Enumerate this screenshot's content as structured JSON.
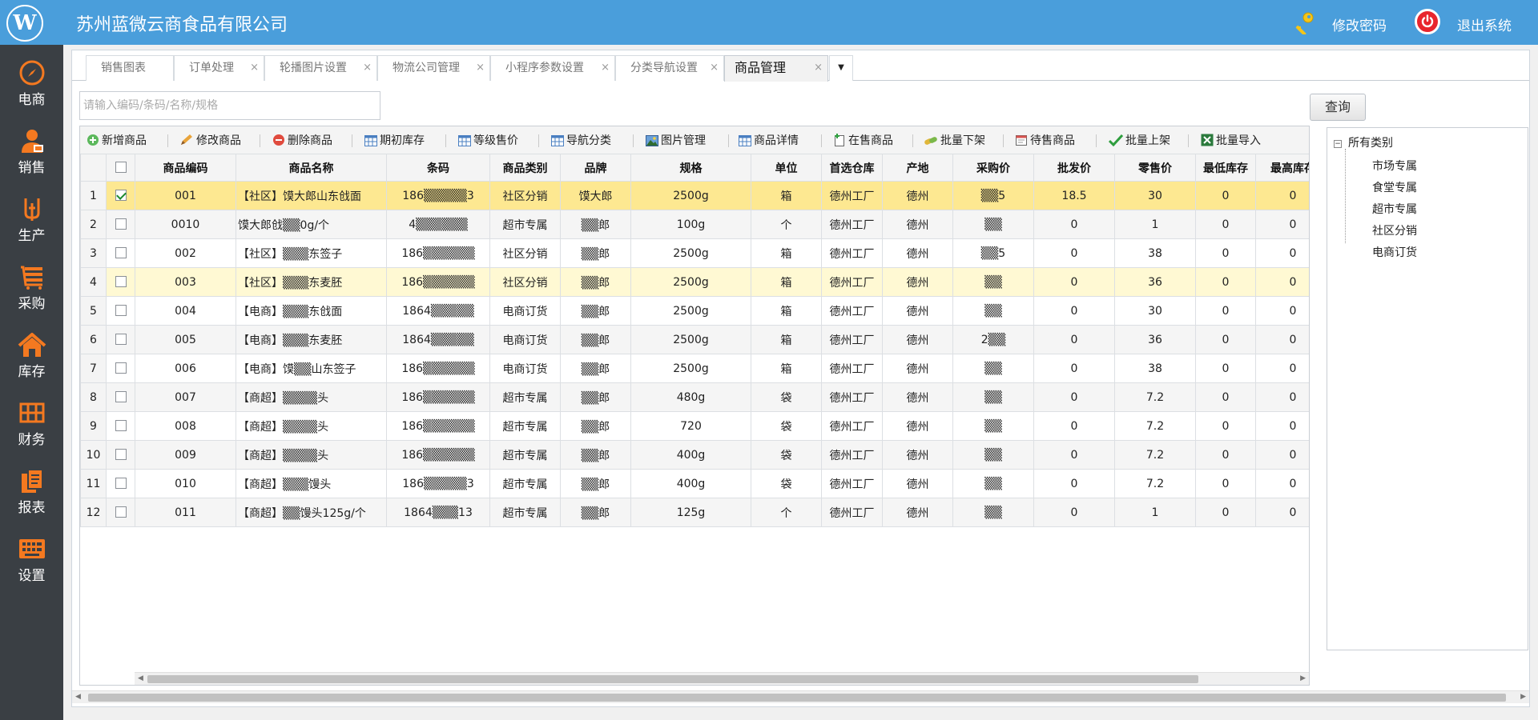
{
  "header": {
    "company_name": "苏州蓝微云商食品有限公司",
    "change_password": "修改密码",
    "logout": "退出系统"
  },
  "sidebar": {
    "items": [
      {
        "label": "电商",
        "icon": "compass-icon"
      },
      {
        "label": "销售",
        "icon": "salesperson-icon"
      },
      {
        "label": "生产",
        "icon": "production-icon"
      },
      {
        "label": "采购",
        "icon": "purchase-list-icon"
      },
      {
        "label": "库存",
        "icon": "warehouse-home-icon"
      },
      {
        "label": "财务",
        "icon": "finance-grid-icon"
      },
      {
        "label": "报表",
        "icon": "report-icon"
      },
      {
        "label": "设置",
        "icon": "keyboard-settings-icon"
      }
    ],
    "accent_color": "#f47920"
  },
  "tabs": [
    {
      "label": "销售图表"
    },
    {
      "label": "订单处理"
    },
    {
      "label": "轮播图片设置"
    },
    {
      "label": "物流公司管理"
    },
    {
      "label": "小程序参数设置"
    },
    {
      "label": "分类导航设置"
    },
    {
      "label": "商品管理"
    }
  ],
  "tab_close_glyph": "×",
  "search": {
    "placeholder": "请输入编码/条码/名称/规格",
    "button": "查询"
  },
  "toolbar": [
    {
      "label": "新增商品",
      "icon": "add-icon"
    },
    {
      "label": "修改商品",
      "icon": "edit-pencil-icon"
    },
    {
      "label": "删除商品",
      "icon": "delete-icon"
    },
    {
      "label": "期初库存",
      "icon": "table-icon"
    },
    {
      "label": "等级售价",
      "icon": "table-icon"
    },
    {
      "label": "导航分类",
      "icon": "table-icon"
    },
    {
      "label": "图片管理",
      "icon": "image-icon"
    },
    {
      "label": "商品详情",
      "icon": "table-icon"
    },
    {
      "label": "在售商品",
      "icon": "document-add-icon"
    },
    {
      "label": "批量下架",
      "icon": "pills-icon"
    },
    {
      "label": "待售商品",
      "icon": "calendar-icon"
    },
    {
      "label": "批量上架",
      "icon": "checkmark-icon"
    },
    {
      "label": "批量导入",
      "icon": "excel-icon"
    }
  ],
  "table": {
    "columns": [
      "商品编码",
      "商品名称",
      "条码",
      "商品类别",
      "品牌",
      "规格",
      "单位",
      "首选仓库",
      "产地",
      "采购价",
      "批发价",
      "零售价",
      "最低库存",
      "最高库存"
    ],
    "rows": [
      {
        "num": "1",
        "checked": true,
        "code": "001",
        "name": "【社区】馍大郎山东戗面",
        "barcode": "186▒▒▒▒▒3",
        "category": "社区分销",
        "brand": "馍大郎",
        "spec": "2500g",
        "unit": "箱",
        "warehouse": "德州工厂",
        "origin": "德州",
        "purchase": "▒▒5",
        "wholesale": "18.5",
        "retail": "30",
        "min": "0",
        "max": "0"
      },
      {
        "num": "2",
        "checked": false,
        "code": "0010",
        "name": "馍大郎戗▒▒0g/个",
        "barcode": "4▒▒▒▒▒▒",
        "category": "超市专属",
        "brand": "▒▒郎",
        "spec": "100g",
        "unit": "个",
        "warehouse": "德州工厂",
        "origin": "德州",
        "purchase": "▒▒",
        "wholesale": "0",
        "retail": "1",
        "min": "0",
        "max": "0"
      },
      {
        "num": "3",
        "checked": false,
        "code": "002",
        "name": "【社区】▒▒▒东签子",
        "barcode": "186▒▒▒▒▒▒",
        "category": "社区分销",
        "brand": "▒▒郎",
        "spec": "2500g",
        "unit": "箱",
        "warehouse": "德州工厂",
        "origin": "德州",
        "purchase": "▒▒5",
        "wholesale": "0",
        "retail": "38",
        "min": "0",
        "max": "0"
      },
      {
        "num": "4",
        "checked": false,
        "code": "003",
        "name": "【社区】▒▒▒东麦胚",
        "barcode": "186▒▒▒▒▒▒",
        "category": "社区分销",
        "brand": "▒▒郎",
        "spec": "2500g",
        "unit": "箱",
        "warehouse": "德州工厂",
        "origin": "德州",
        "purchase": "▒▒",
        "wholesale": "0",
        "retail": "36",
        "min": "0",
        "max": "0"
      },
      {
        "num": "5",
        "checked": false,
        "code": "004",
        "name": "【电商】▒▒▒东戗面",
        "barcode": "1864▒▒▒▒▒",
        "category": "电商订货",
        "brand": "▒▒郎",
        "spec": "2500g",
        "unit": "箱",
        "warehouse": "德州工厂",
        "origin": "德州",
        "purchase": "▒▒",
        "wholesale": "0",
        "retail": "30",
        "min": "0",
        "max": "0"
      },
      {
        "num": "6",
        "checked": false,
        "code": "005",
        "name": "【电商】▒▒▒东麦胚",
        "barcode": "1864▒▒▒▒▒",
        "category": "电商订货",
        "brand": "▒▒郎",
        "spec": "2500g",
        "unit": "箱",
        "warehouse": "德州工厂",
        "origin": "德州",
        "purchase": "2▒▒",
        "wholesale": "0",
        "retail": "36",
        "min": "0",
        "max": "0"
      },
      {
        "num": "7",
        "checked": false,
        "code": "006",
        "name": "【电商】馍▒▒山东签子",
        "barcode": "186▒▒▒▒▒▒",
        "category": "电商订货",
        "brand": "▒▒郎",
        "spec": "2500g",
        "unit": "箱",
        "warehouse": "德州工厂",
        "origin": "德州",
        "purchase": "▒▒",
        "wholesale": "0",
        "retail": "38",
        "min": "0",
        "max": "0"
      },
      {
        "num": "8",
        "checked": false,
        "code": "007",
        "name": "【商超】▒▒▒▒头",
        "barcode": "186▒▒▒▒▒▒",
        "category": "超市专属",
        "brand": "▒▒郎",
        "spec": "480g",
        "unit": "袋",
        "warehouse": "德州工厂",
        "origin": "德州",
        "purchase": "▒▒",
        "wholesale": "0",
        "retail": "7.2",
        "min": "0",
        "max": "0"
      },
      {
        "num": "9",
        "checked": false,
        "code": "008",
        "name": "【商超】▒▒▒▒头",
        "barcode": "186▒▒▒▒▒▒",
        "category": "超市专属",
        "brand": "▒▒郎",
        "spec": "720",
        "unit": "袋",
        "warehouse": "德州工厂",
        "origin": "德州",
        "purchase": "▒▒",
        "wholesale": "0",
        "retail": "7.2",
        "min": "0",
        "max": "0"
      },
      {
        "num": "10",
        "checked": false,
        "code": "009",
        "name": "【商超】▒▒▒▒头",
        "barcode": "186▒▒▒▒▒▒",
        "category": "超市专属",
        "brand": "▒▒郎",
        "spec": "400g",
        "unit": "袋",
        "warehouse": "德州工厂",
        "origin": "德州",
        "purchase": "▒▒",
        "wholesale": "0",
        "retail": "7.2",
        "min": "0",
        "max": "0"
      },
      {
        "num": "11",
        "checked": false,
        "code": "010",
        "name": "【商超】▒▒▒馒头",
        "barcode": "186▒▒▒▒▒3",
        "category": "超市专属",
        "brand": "▒▒郎",
        "spec": "400g",
        "unit": "袋",
        "warehouse": "德州工厂",
        "origin": "德州",
        "purchase": "▒▒",
        "wholesale": "0",
        "retail": "7.2",
        "min": "0",
        "max": "0"
      },
      {
        "num": "12",
        "checked": false,
        "code": "011",
        "name": "【商超】▒▒馒头125g/个",
        "barcode": "1864▒▒▒13",
        "category": "超市专属",
        "brand": "▒▒郎",
        "spec": "125g",
        "unit": "个",
        "warehouse": "德州工厂",
        "origin": "德州",
        "purchase": "▒▒",
        "wholesale": "0",
        "retail": "1",
        "min": "0",
        "max": "0"
      }
    ],
    "selected_row_color": "#fde891",
    "hover_row_color": "#fff9d3"
  },
  "tree": {
    "root": "所有类别",
    "items": [
      "市场专属",
      "食堂专属",
      "超市专属",
      "社区分销",
      "电商订货"
    ]
  },
  "colors": {
    "header_bg": "#4a9edb",
    "sidebar_bg": "#3a3f44"
  }
}
